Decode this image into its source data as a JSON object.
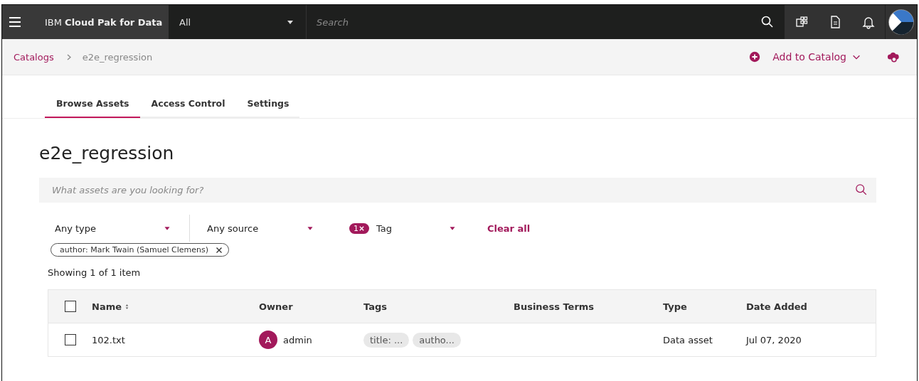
{
  "header": {
    "product": "IBM **Cloud Pak for Data**",
    "scope": "All",
    "search": {
      "placeholder": "Search"
    }
  },
  "breadcrumb": {
    "items": [
      "Catalogs",
      "e2e_regression"
    ],
    "action": "Add to Catalog"
  },
  "tabs": [
    {
      "label": "Browse Assets",
      "selected": true
    },
    {
      "label": "Access Control",
      "selected": false
    },
    {
      "label": "Settings",
      "selected": false
    }
  ],
  "title": "e2e_regression",
  "asset_search": {
    "placeholder": "What assets are you looking for?"
  },
  "filters": [
    {
      "label": "Any type"
    },
    {
      "label": "Any source"
    },
    {
      "label": "Tag",
      "count": "1"
    }
  ],
  "clear_all": "Clear all",
  "active_filters": [
    "author: Mark Twain (Samuel Clemens)"
  ],
  "result_count": "Showing 1 of 1 item",
  "table": {
    "columns": [
      {
        "label": "Name",
        "sortable": true
      },
      {
        "label": "Owner",
        "sortable": false
      },
      {
        "label": "Tags",
        "sortable": false
      },
      {
        "label": "Business Terms",
        "sortable": false
      },
      {
        "label": "Type",
        "sortable": false
      },
      {
        "label": "Date Added",
        "sortable": false
      }
    ],
    "header_checked": false,
    "rows": [
      {
        "checked": false,
        "name": "102.txt",
        "owner_initial": "A",
        "owner": "admin",
        "tags": [
          "title: ...",
          "autho..."
        ],
        "business_terms": "",
        "type": "Data asset",
        "date_added": "Jul 07, 2020"
      }
    ]
  }
}
